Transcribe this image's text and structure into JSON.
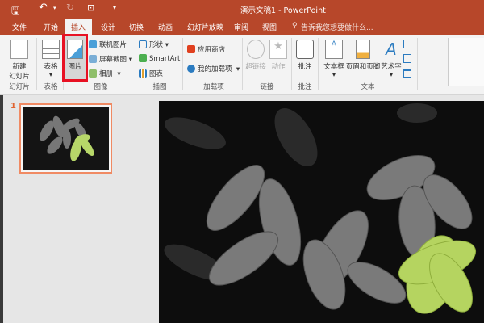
{
  "title_bar": {
    "title": "演示文稿1 - PowerPoint",
    "save_icon": "save-icon",
    "undo_icon": "undo-icon",
    "redo_icon": "redo-icon"
  },
  "tabs": [
    "文件",
    "开始",
    "插入",
    "设计",
    "切换",
    "动画",
    "幻灯片放映",
    "审阅",
    "视图"
  ],
  "active_tab": "插入",
  "tell_me": "告诉我您想要做什么...",
  "ribbon": {
    "new_slide": "新建\n幻灯片",
    "new_slide_l1": "新建",
    "new_slide_l2": "幻灯片",
    "table": "表格",
    "picture": "图片",
    "online_pictures": "联机图片",
    "screenshot": "屏幕截图",
    "album": "相册",
    "shapes": "形状",
    "smartart": "SmartArt",
    "chart": "图表",
    "store": "应用商店",
    "my_addins": "我的加载项",
    "hyperlink": "超链接",
    "action": "动作",
    "comment": "批注",
    "textbox": "文本框",
    "header_footer": "页眉和页脚",
    "wordart": "艺术字",
    "groups": {
      "slides": "幻灯片",
      "tables": "表格",
      "images": "图像",
      "illustrations": "插图",
      "addins": "加载项",
      "links": "链接",
      "comments": "批注",
      "text": "文本"
    }
  },
  "slides": {
    "number": "1"
  },
  "colors": {
    "accent": "#b7472a",
    "highlight": "#e81123",
    "thumb_border": "#f08a63"
  }
}
